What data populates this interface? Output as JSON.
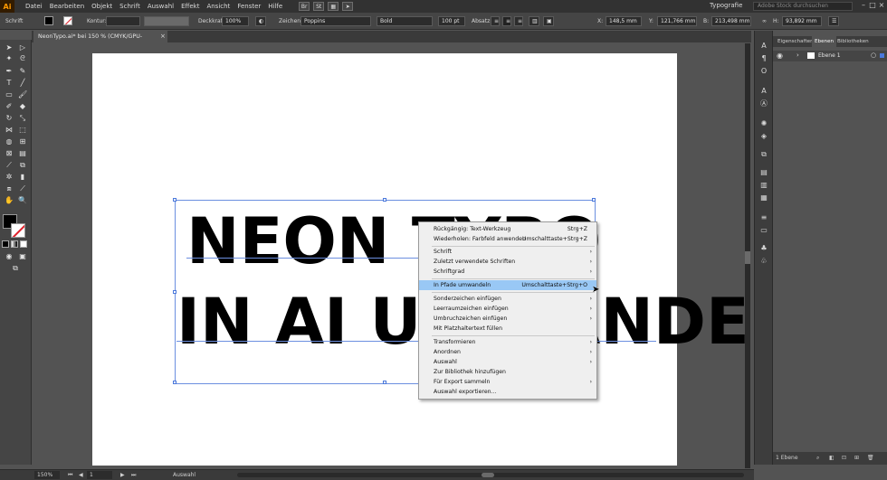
{
  "menubar": {
    "logo": "Ai",
    "items": [
      "Datei",
      "Bearbeiten",
      "Objekt",
      "Schrift",
      "Auswahl",
      "Effekt",
      "Ansicht",
      "Fenster",
      "Hilfe"
    ],
    "bridge": "Br",
    "stock": "St",
    "workspace": "Typografie",
    "search_placeholder": "Adobe Stock durchsuchen"
  },
  "controlbar": {
    "context": "Schrift",
    "kontur_label": "Kontur:",
    "deckkraft_label": "Deckkraft:",
    "deckkraft_value": "100%",
    "zeichen_label": "Zeichen:",
    "font_family": "Poppins",
    "font_style": "Bold",
    "font_size": "100 pt",
    "absatz_label": "Absatz:",
    "x_label": "X:",
    "x_value": "148,5 mm",
    "y_label": "Y:",
    "y_value": "121,766 mm",
    "b_label": "B:",
    "b_value": "213,498 mm",
    "h_label": "H:",
    "h_value": "93,892 mm"
  },
  "tab": {
    "title": "NeonTypo.ai* bei 150 % (CMYK/GPU-Vorschau)",
    "close": "×"
  },
  "canvas": {
    "line1": "NEON TYPO",
    "line2": "IN AI UMWANDELN"
  },
  "context_menu": {
    "items": [
      {
        "label": "Rückgängig: Text-Werkzeug",
        "shortcut": "Strg+Z"
      },
      {
        "label": "Wiederholen: Farbfeld anwenden",
        "shortcut": "Umschalttaste+Strg+Z"
      },
      {
        "label": "Schrift",
        "submenu": true
      },
      {
        "label": "Zuletzt verwendete Schriften",
        "submenu": true
      },
      {
        "label": "Schriftgrad",
        "submenu": true
      },
      {
        "label": "In Pfade umwandeln",
        "shortcut": "Umschalttaste+Strg+O",
        "highlighted": true
      },
      {
        "label": "Sonderzeichen einfügen",
        "submenu": true
      },
      {
        "label": "Leerraumzeichen einfügen",
        "submenu": true
      },
      {
        "label": "Umbruchzeichen einfügen",
        "submenu": true
      },
      {
        "label": "Mit Platzhaltertext füllen"
      },
      {
        "label": "Transformieren",
        "submenu": true
      },
      {
        "label": "Anordnen",
        "submenu": true
      },
      {
        "label": "Auswahl",
        "submenu": true
      },
      {
        "label": "Zur Bibliothek hinzufügen"
      },
      {
        "label": "Für Export sammeln",
        "submenu": true
      },
      {
        "label": "Auswahl exportieren..."
      }
    ],
    "submenu_arrow": "›",
    "highlight_color": "#99c8f5"
  },
  "panel": {
    "tabs": [
      "Eigenschaften",
      "Ebenen",
      "Bibliotheken"
    ],
    "active_tab": "Ebenen",
    "layer_name": "Ebene 1",
    "footer": "1 Ebene"
  },
  "statusbar": {
    "zoom": "150%",
    "artboard_number": "1",
    "tool": "Auswahl"
  },
  "colors": {
    "accent_selection": "#4a78db",
    "logo_orange": "#ff9a00",
    "none_stroke_red": "#e0202a"
  }
}
